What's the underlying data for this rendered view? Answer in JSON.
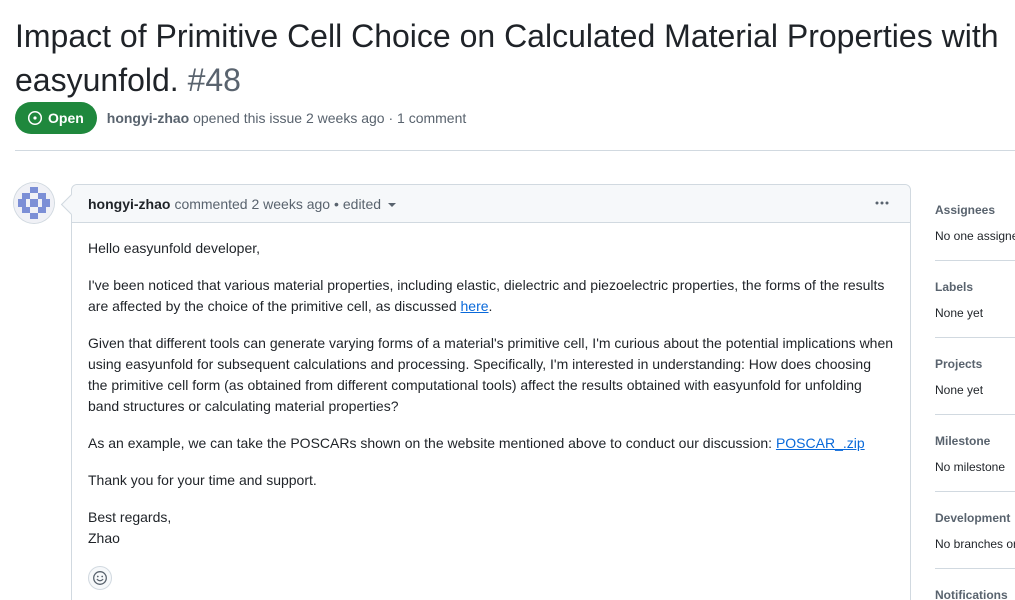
{
  "issue": {
    "title": "Impact of Primitive Cell Choice on Calculated Material Properties with easyunfold.",
    "number": "#48",
    "state": "Open",
    "author": "hongyi-zhao",
    "opened_text": "opened this issue 2 weeks ago · 1 comment"
  },
  "comment": {
    "author": "hongyi-zhao",
    "commented_text": "commented 2 weeks ago •",
    "edited_label": "edited",
    "greeting": "Hello easyunfold developer,",
    "para1_text": "I've been noticed that various material properties, including elastic, dielectric and piezoelectric properties, the forms of the results are affected by the choice of the primitive cell, as discussed ",
    "para1_link": "here",
    "para1_end": ".",
    "para2": "Given that different tools can generate varying forms of a material's primitive cell, I'm curious about the potential implications when using easyunfold for subsequent calculations and processing. Specifically, I'm interested in understanding: How does choosing the primitive cell form (as obtained from different computational tools) affect the results obtained with easyunfold for unfolding band structures or calculating material properties?",
    "para3_text": "As an example, we can take the POSCARs shown on the website mentioned above to conduct our discussion: ",
    "para3_link": "POSCAR_.zip",
    "para4": "Thank you for your time and support.",
    "closing": "Best regards,",
    "signature": "Zhao"
  },
  "sidebar": {
    "sections": [
      {
        "heading": "Assignees",
        "value": "No one assigned"
      },
      {
        "heading": "Labels",
        "value": "None yet"
      },
      {
        "heading": "Projects",
        "value": "None yet"
      },
      {
        "heading": "Milestone",
        "value": "No milestone"
      },
      {
        "heading": "Development",
        "value": "No branches or pull requests"
      },
      {
        "heading": "Notifications",
        "value": ""
      }
    ]
  },
  "colors": {
    "open_badge": "#1f883d",
    "link": "#0969da",
    "muted_text": "#59636e",
    "border": "#d1d9e0"
  },
  "icons": {
    "state": "issue-opened-icon",
    "menu": "kebab-horizontal-icon",
    "reaction": "smiley-icon",
    "dropdown": "triangle-down-icon"
  }
}
